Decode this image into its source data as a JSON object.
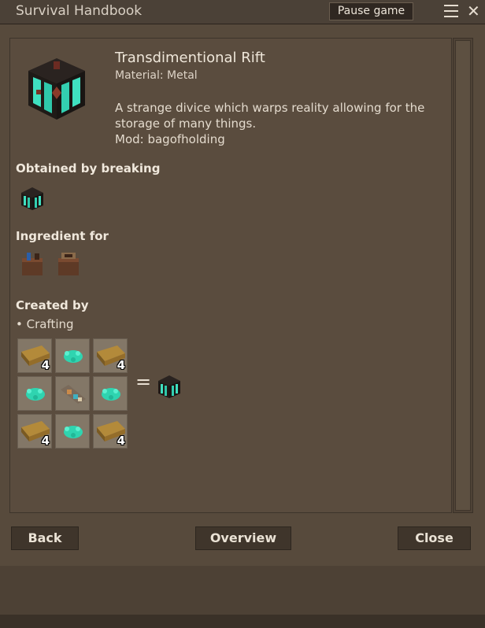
{
  "window": {
    "title": "Survival Handbook",
    "pause_label": "Pause game"
  },
  "item": {
    "name": "Transdimentional Rift",
    "material": "Material: Metal",
    "description": "A strange divice which warps reality allowing for the storage of many things.",
    "mod": "Mod: bagofholding"
  },
  "sections": {
    "obtained": "Obtained by breaking",
    "ingredient": "Ingredient for",
    "created": "Created by",
    "method": "• Crafting"
  },
  "recipe": {
    "cells": [
      {
        "icon": "plank-icon",
        "qty": "4"
      },
      {
        "icon": "crystal-icon",
        "qty": ""
      },
      {
        "icon": "plank-icon",
        "qty": "4"
      },
      {
        "icon": "crystal-icon",
        "qty": ""
      },
      {
        "icon": "device-icon",
        "qty": ""
      },
      {
        "icon": "crystal-icon",
        "qty": ""
      },
      {
        "icon": "plank-icon",
        "qty": "4"
      },
      {
        "icon": "crystal-icon",
        "qty": ""
      },
      {
        "icon": "plank-icon",
        "qty": "4"
      }
    ],
    "equals": "="
  },
  "buttons": {
    "back": "Back",
    "overview": "Overview",
    "close": "Close"
  },
  "colors": {
    "accent_cyan": "#3fe0c0",
    "panel": "#5a4c3e",
    "button": "#3f352b"
  }
}
